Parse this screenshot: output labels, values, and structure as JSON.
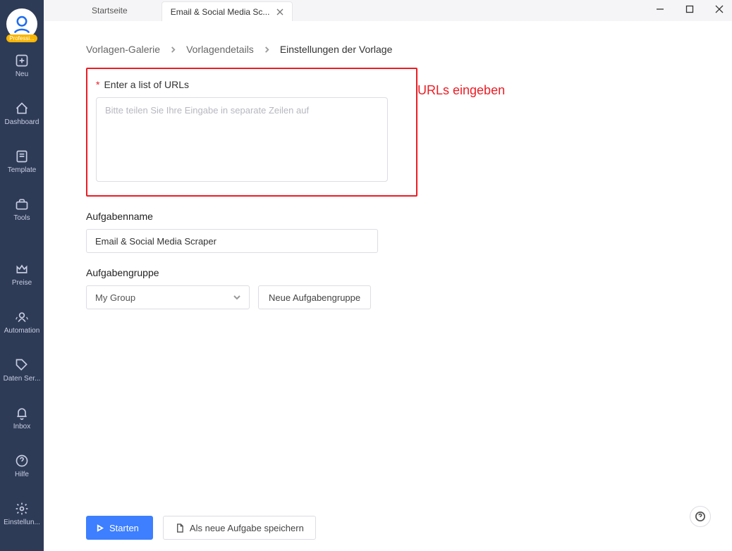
{
  "sidebar": {
    "badge_label": "Professi...",
    "items": [
      {
        "label": "Neu"
      },
      {
        "label": "Dashboard"
      },
      {
        "label": "Template"
      },
      {
        "label": "Tools"
      },
      {
        "label": "Preise"
      },
      {
        "label": "Automation"
      },
      {
        "label": "Daten Ser..."
      },
      {
        "label": "Inbox"
      },
      {
        "label": "Hilfe"
      },
      {
        "label": "Einstellun..."
      }
    ]
  },
  "tabs": {
    "home_label": "Startseite",
    "active_label": "Email & Social Media Sc..."
  },
  "breadcrumb": {
    "items": [
      "Vorlagen-Galerie",
      "Vorlagendetails",
      "Einstellungen der Vorlage"
    ]
  },
  "form": {
    "urls_label": "Enter a list of URLs",
    "urls_placeholder": "Bitte teilen Sie Ihre Eingabe in separate Zeilen auf",
    "annotation": "URLs eingeben",
    "task_name_label": "Aufgabenname",
    "task_name_value": "Email & Social Media Scraper",
    "task_group_label": "Aufgabengruppe",
    "group_selected": "My Group",
    "new_group_button": "Neue Aufgabengruppe"
  },
  "footer": {
    "start_button": "Starten",
    "save_as_button": "Als neue Aufgabe speichern"
  }
}
